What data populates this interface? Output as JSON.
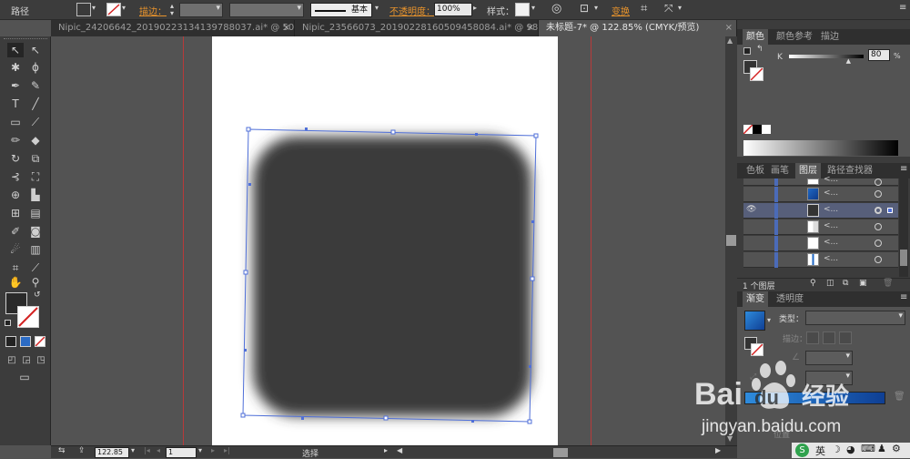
{
  "control_bar": {
    "object_type": "路径",
    "stroke_label": "描边：",
    "brush_label": "基本",
    "opacity_label": "不透明度：",
    "opacity_value": "100%",
    "style_label": "样式：",
    "transform_label": "变换"
  },
  "tabs": [
    {
      "label": "Nipic_24206642_20190223134139788037.ai* @ 50..."
    },
    {
      "label": "Nipic_23566073_20190228160509458084.ai* @ 98..."
    },
    {
      "label": "未标题-7* @ 122.85% (CMYK/预览)"
    }
  ],
  "color_panel": {
    "tabs": [
      "颜色",
      "颜色参考",
      "描边"
    ],
    "channel_label": "K",
    "channel_value": "80",
    "unit": "%",
    "k_level": 0.8
  },
  "layers_panel": {
    "tabs": [
      "色板",
      "画笔",
      "图层",
      "路径查找器"
    ],
    "row_label": "<...",
    "rows": 7,
    "footer": "1 个图层"
  },
  "gradient_panel": {
    "tabs": [
      "渐变",
      "透明度"
    ],
    "type_label": "类型：",
    "stroke_label": "描边：",
    "location_label": "位置"
  },
  "status_bar": {
    "zoom": "122.85",
    "page": "1",
    "tool_status": "选择"
  },
  "taskbar": {
    "ime": "英"
  },
  "watermark": {
    "brand": "Bai du经验",
    "url": "jingyan.baidu.com"
  },
  "colors": {
    "shape_fill": "#3b3b3b",
    "guide": "#b83a3a",
    "selection": "#4f6fd8",
    "layer_bar": "#4b6bb8",
    "ui_dark": "#3c3c3c",
    "ui_mid": "#535353"
  }
}
